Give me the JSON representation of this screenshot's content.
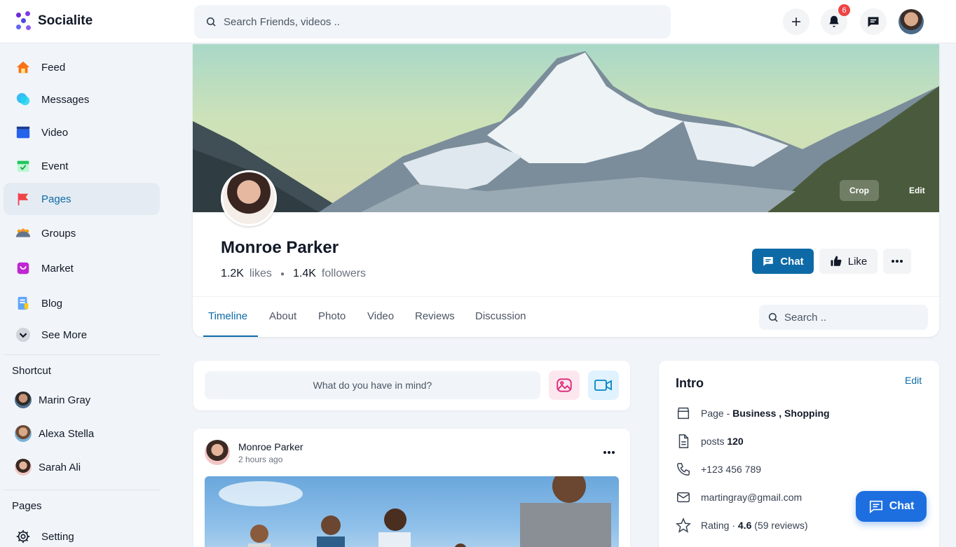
{
  "app": {
    "name": "Socialite"
  },
  "header": {
    "search_placeholder": "Search Friends, videos ..",
    "notification_count": "6"
  },
  "sidebar": {
    "items": [
      {
        "label": "Feed",
        "icon": "home-icon"
      },
      {
        "label": "Messages",
        "icon": "messages-icon"
      },
      {
        "label": "Video",
        "icon": "video-icon"
      },
      {
        "label": "Event",
        "icon": "calendar-icon"
      },
      {
        "label": "Pages",
        "icon": "flag-icon",
        "active": true
      },
      {
        "label": "Groups",
        "icon": "groups-icon"
      },
      {
        "label": "Market",
        "icon": "shopping-bag-icon"
      },
      {
        "label": "Blog",
        "icon": "blog-icon"
      },
      {
        "label": "See More",
        "icon": "chevron-down-icon"
      }
    ],
    "shortcut_title": "Shortcut",
    "shortcuts": [
      {
        "label": "Marin Gray"
      },
      {
        "label": "Alexa Stella"
      },
      {
        "label": "Sarah Ali"
      }
    ],
    "pages_title": "Pages",
    "pages_items": [
      {
        "label": "Setting",
        "icon": "gear-icon"
      }
    ]
  },
  "profile": {
    "cover_crop": "Crop",
    "cover_edit": "Edit",
    "name": "Monroe Parker",
    "likes_count": "1.2K",
    "likes_label": "likes",
    "followers_count": "1.4K",
    "followers_label": "followers",
    "chat_button": "Chat",
    "like_button": "Like",
    "tabs": [
      "Timeline",
      "About",
      "Photo",
      "Video",
      "Reviews",
      "Discussion"
    ],
    "active_tab": "Timeline",
    "search_placeholder": "Search .."
  },
  "composer": {
    "placeholder": "What do you have in mind?"
  },
  "post": {
    "author": "Monroe Parker",
    "time": "2 hours ago"
  },
  "intro": {
    "title": "Intro",
    "edit": "Edit",
    "page_prefix": "Page -",
    "page_categories": "Business , Shopping",
    "posts_label": "posts",
    "posts_count": "120",
    "phone": "+123 456 789",
    "email": "martingray@gmail.com",
    "rating_label": "Rating ·",
    "rating_value": "4.6",
    "rating_reviews": "(59 reviews)"
  },
  "float_chat": {
    "label": "Chat"
  },
  "colors": {
    "accent": "#0e6aa6",
    "brand": "#6d28d9",
    "float_chat": "#1d6fe0",
    "badge": "#ef4444"
  }
}
